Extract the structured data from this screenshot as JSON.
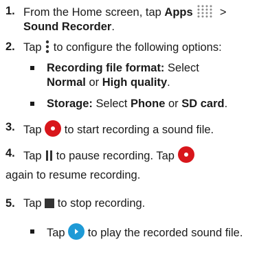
{
  "steps": [
    {
      "num": "1.",
      "t1": "From the Home screen, tap ",
      "b1": "Apps",
      "t2": " > ",
      "b2": "Sound Recorder",
      "t3": "."
    },
    {
      "num": "2.",
      "t1": "Tap ",
      "t2": " to configure the following options:"
    },
    {
      "num": "3.",
      "t1": "Tap ",
      "t2": " to start recording a sound file."
    },
    {
      "num": "4.",
      "t1": "Tap ",
      "t2": " to pause recording. Tap ",
      "t3": " again to resume recording."
    },
    {
      "num": "5.",
      "t1": "Tap ",
      "t2": " to stop recording."
    }
  ],
  "options": [
    {
      "b1": "Recording file format:",
      "t1": " Select ",
      "b2": "Normal",
      "t2": " or ",
      "b3": "High quality",
      "t3": "."
    },
    {
      "b1": "Storage:",
      "t1": " Select ",
      "b2": "Phone",
      "t2": " or ",
      "b3": "SD card",
      "t3": "."
    }
  ],
  "play_note": {
    "t1": "Tap ",
    "t2": " to play the recorded sound file."
  },
  "icons": {
    "apps": "apps-grid-icon",
    "menu": "more-options-icon",
    "record": "record-icon",
    "pause": "pause-icon",
    "stop": "stop-icon",
    "play": "play-icon"
  },
  "colors": {
    "record": "#d8161b",
    "play": "#1e9ad6"
  }
}
